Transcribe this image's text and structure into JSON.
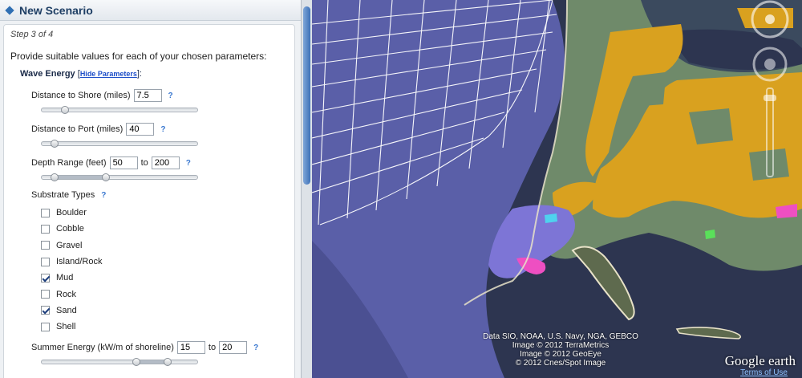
{
  "panel": {
    "title": "New Scenario",
    "step": "Step 3 of 4",
    "intro": "Provide suitable values for each of your chosen parameters:",
    "group": {
      "title": "Wave Energy",
      "hide_open": "[",
      "hide_link": "Hide Parameters",
      "hide_close": "]:"
    },
    "params": {
      "distance_shore": {
        "label": "Distance to Shore (miles)",
        "value": "7.5",
        "help": "?",
        "slider": 0.15
      },
      "distance_port": {
        "label": "Distance to Port (miles)",
        "value": "40",
        "help": "?",
        "slider": 0.08
      },
      "depth_range": {
        "label": "Depth Range (feet)",
        "from": "50",
        "to_label": "to",
        "to": "200",
        "help": "?",
        "slider_from": 0.08,
        "slider_to": 0.41
      },
      "summer_energy": {
        "label": "Summer Energy (kW/m of shoreline)",
        "from": "15",
        "to_label": "to",
        "to": "20",
        "help": "?",
        "slider_from": 0.61,
        "slider_to": 0.81
      }
    },
    "substrate": {
      "title": "Substrate Types",
      "help": "?",
      "items": [
        {
          "label": "Boulder",
          "checked": false
        },
        {
          "label": "Cobble",
          "checked": false
        },
        {
          "label": "Gravel",
          "checked": false
        },
        {
          "label": "Island/Rock",
          "checked": false
        },
        {
          "label": "Mud",
          "checked": true
        },
        {
          "label": "Rock",
          "checked": false
        },
        {
          "label": "Sand",
          "checked": true
        },
        {
          "label": "Shell",
          "checked": false
        }
      ]
    }
  },
  "map": {
    "attribution": [
      "Data SIO, NOAA, U.S. Navy, NGA, GEBCO",
      "Image © 2012 TerraMetrics",
      "Image © 2012 GeoEye",
      "© 2012 Cnes/Spot Image"
    ],
    "logo": "Google earth",
    "terms": "Terms of Use",
    "colors": {
      "ocean": "#5a5fa8",
      "land": "#6f8a6a",
      "suitable": "#d9a11f",
      "mud": "#7d75d6",
      "highlight": "#ee4fc2",
      "grid": "#ffffff"
    }
  }
}
